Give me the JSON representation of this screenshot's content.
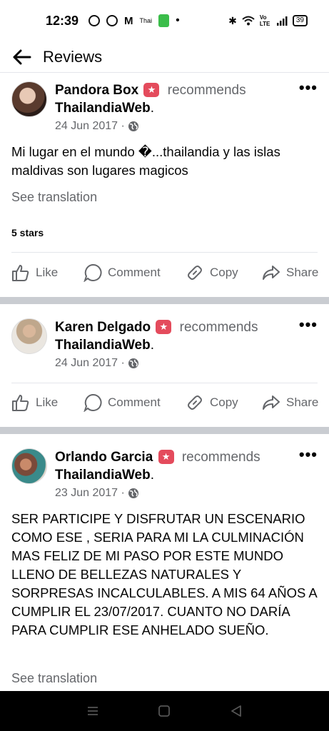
{
  "status": {
    "time": "12:39",
    "network": "Vo LTE",
    "battery": "39"
  },
  "header": {
    "title": "Reviews"
  },
  "reviews": [
    {
      "name": "Pandora Box",
      "recommends": "recommends",
      "page": "ThailandiaWeb",
      "date": "24 Jun 2017 ·",
      "text": "Mi lugar en el mundo �...thailandia y las islas maldivas son lugares magicos",
      "see_translation": "See translation",
      "stars": "5 stars"
    },
    {
      "name": "Karen Delgado",
      "recommends": "recommends",
      "page": "ThailandiaWeb",
      "date": "24 Jun 2017 ·"
    },
    {
      "name": "Orlando Garcia",
      "recommends": "recommends",
      "page": "ThailandiaWeb",
      "date": "23 Jun 2017 ·",
      "text": "SER PARTICIPE Y DISFRUTAR UN ESCENARIO COMO ESE , SERIA PARA MI LA CULMINACIÓN MAS FELIZ DE MI PASO POR ESTE MUNDO LLENO DE BELLEZAS NATURALES Y SORPRESAS INCALCULABLES. A MIS 64 AÑOS A CUMPLIR EL 23/07/2017. CUANTO NO DARÍA PARA CUMPLIR ESE ANHELADO SUEÑO.",
      "see_translation": "See translation"
    }
  ],
  "actions": {
    "like": "Like",
    "comment": "Comment",
    "copy": "Copy",
    "share": "Share"
  },
  "icons": {
    "back": "arrow-left-icon",
    "more": "more-horizontal-icon",
    "globe": "globe-icon",
    "recommend": "recommend-badge-icon"
  },
  "colors": {
    "recommend_badge": "#e44b5c",
    "secondary_text": "#65676b",
    "separator": "#c9ccd1"
  }
}
